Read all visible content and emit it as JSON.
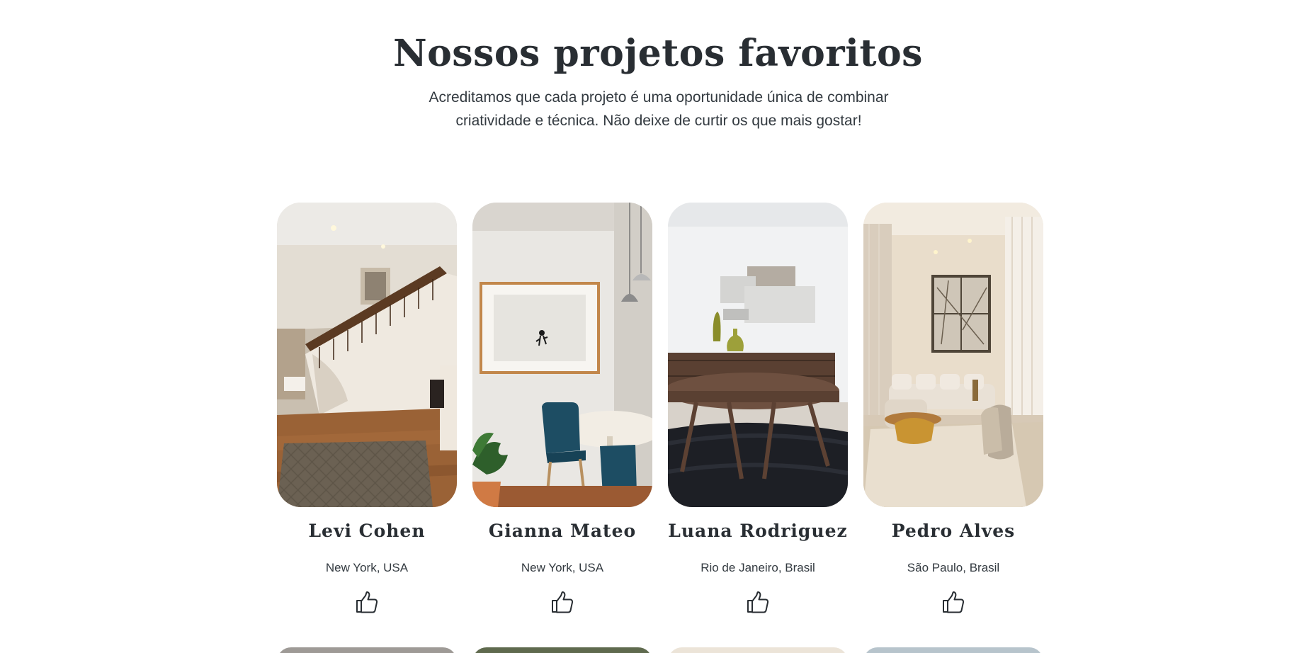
{
  "header": {
    "title": "Nossos projetos favoritos",
    "subtitle": "Acreditamos que cada projeto é uma oportunidade única de combinar criatividade e técnica. Não deixe de curtir os que mais gostar!"
  },
  "projects": [
    {
      "name": "Levi Cohen",
      "location": "New York, USA",
      "photo_icon": "staircase-interior-photo",
      "like_icon": "thumbs-up-icon"
    },
    {
      "name": "Gianna Mateo",
      "location": "New York, USA",
      "photo_icon": "dining-corner-photo",
      "like_icon": "thumbs-up-icon"
    },
    {
      "name": "Luana Rodriguez",
      "location": "Rio de Janeiro, Brasil",
      "photo_icon": "sideboard-round-table-photo",
      "like_icon": "thumbs-up-icon"
    },
    {
      "name": "Pedro Alves",
      "location": "São Paulo, Brasil",
      "photo_icon": "bright-living-room-photo",
      "like_icon": "thumbs-up-icon"
    }
  ],
  "colors": {
    "text": "#292e33",
    "background": "#ffffff"
  }
}
